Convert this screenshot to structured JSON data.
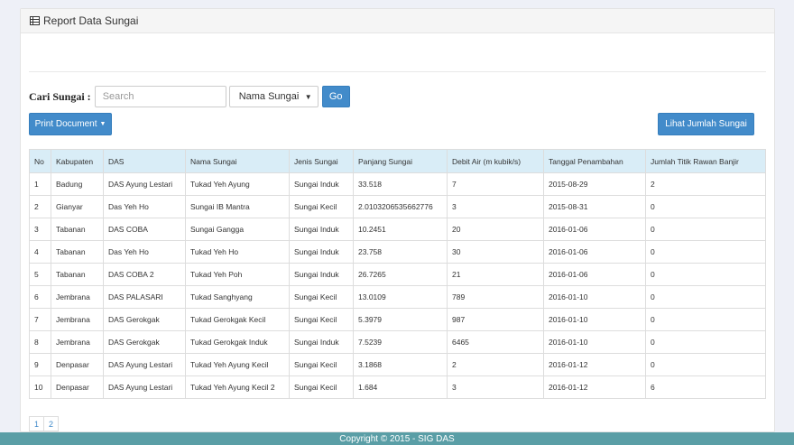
{
  "header": {
    "title": "Report Data Sungai",
    "icon": "table-icon"
  },
  "search": {
    "label": "Cari Sungai :",
    "placeholder": "Search",
    "select_value": "Nama Sungai",
    "go_label": "Go"
  },
  "buttons": {
    "print_label": "Print Document",
    "lihat_label": "Lihat Jumlah Sungai"
  },
  "table": {
    "headers": [
      "No",
      "Kabupaten",
      "DAS",
      "Nama Sungai",
      "Jenis Sungai",
      "Panjang Sungai",
      "Debit Air (m kubik/s)",
      "Tanggal Penambahan",
      "Jumlah Titik Rawan Banjir"
    ],
    "rows": [
      [
        "1",
        "Badung",
        "DAS Ayung Lestari",
        "Tukad Yeh Ayung",
        "Sungai Induk",
        "33.518",
        "7",
        "2015-08-29",
        "2"
      ],
      [
        "2",
        "Gianyar",
        "Das Yeh Ho",
        "Sungai IB Mantra",
        "Sungai Kecil",
        "2.0103206535662776",
        "3",
        "2015-08-31",
        "0"
      ],
      [
        "3",
        "Tabanan",
        "DAS COBA",
        "Sungai Gangga",
        "Sungai Induk",
        "10.2451",
        "20",
        "2016-01-06",
        "0"
      ],
      [
        "4",
        "Tabanan",
        "Das Yeh Ho",
        "Tukad Yeh Ho",
        "Sungai Induk",
        "23.758",
        "30",
        "2016-01-06",
        "0"
      ],
      [
        "5",
        "Tabanan",
        "DAS COBA 2",
        "Tukad Yeh Poh",
        "Sungai Induk",
        "26.7265",
        "21",
        "2016-01-06",
        "0"
      ],
      [
        "6",
        "Jembrana",
        "DAS PALASARI",
        "Tukad Sanghyang",
        "Sungai Kecil",
        "13.0109",
        "789",
        "2016-01-10",
        "0"
      ],
      [
        "7",
        "Jembrana",
        "DAS Gerokgak",
        "Tukad Gerokgak Kecil",
        "Sungai Kecil",
        "5.3979",
        "987",
        "2016-01-10",
        "0"
      ],
      [
        "8",
        "Jembrana",
        "DAS Gerokgak",
        "Tukad Gerokgak Induk",
        "Sungai Induk",
        "7.5239",
        "6465",
        "2016-01-10",
        "0"
      ],
      [
        "9",
        "Denpasar",
        "DAS Ayung Lestari",
        "Tukad Yeh Ayung Kecil",
        "Sungai Kecil",
        "3.1868",
        "2",
        "2016-01-12",
        "0"
      ],
      [
        "10",
        "Denpasar",
        "DAS Ayung Lestari",
        "Tukad Yeh Ayung Kecil 2",
        "Sungai Kecil",
        "1.684",
        "3",
        "2016-01-12",
        "6"
      ]
    ]
  },
  "pagination": [
    "1",
    "2"
  ],
  "footer": {
    "text": "Copyright © 2015 - SIG DAS"
  },
  "colors": {
    "primary": "#428bca",
    "table_header": "#d9edf7",
    "footer": "#5a9ea6"
  }
}
